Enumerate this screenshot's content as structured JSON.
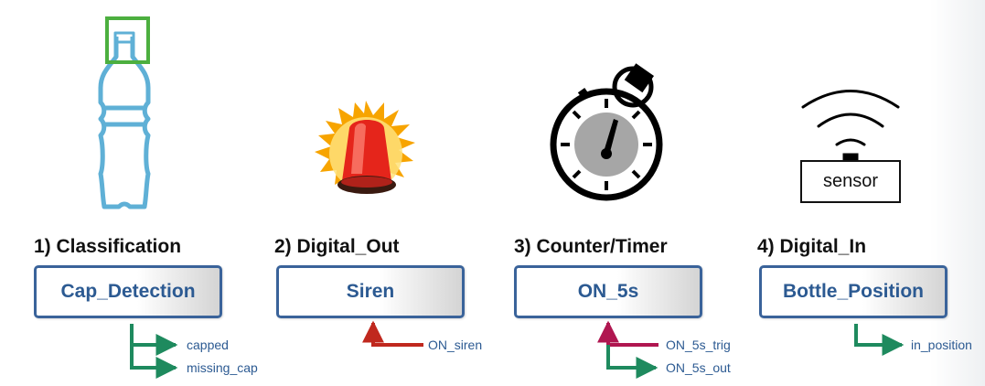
{
  "sections": [
    {
      "heading": "1) Classification",
      "block": "Cap_Detection",
      "ports": [
        {
          "label": "capped",
          "direction": "out"
        },
        {
          "label": "missing_cap",
          "direction": "out"
        }
      ]
    },
    {
      "heading": "2) Digital_Out",
      "block": "Siren",
      "ports": [
        {
          "label": "ON_siren",
          "direction": "in"
        }
      ]
    },
    {
      "heading": "3) Counter/Timer",
      "block": "ON_5s",
      "ports": [
        {
          "label": "ON_5s_trig",
          "direction": "in"
        },
        {
          "label": "ON_5s_out",
          "direction": "out"
        }
      ]
    },
    {
      "heading": "4) Digital_In",
      "block": "Bottle_Position",
      "ports": [
        {
          "label": "in_position",
          "direction": "out"
        }
      ]
    }
  ],
  "sensor_text": "sensor",
  "icons": [
    "bottle-icon",
    "siren-icon",
    "stopwatch-icon",
    "sensor-icon"
  ],
  "colors": {
    "block_border": "#3a639a",
    "block_text": "#2c5a92",
    "output_arrow": "#1e8a5e",
    "input_arrow_siren": "#c0281e",
    "input_arrow_timer": "#b01650",
    "bottle": "#5fb0d6",
    "detection_box": "#4caf3f"
  }
}
